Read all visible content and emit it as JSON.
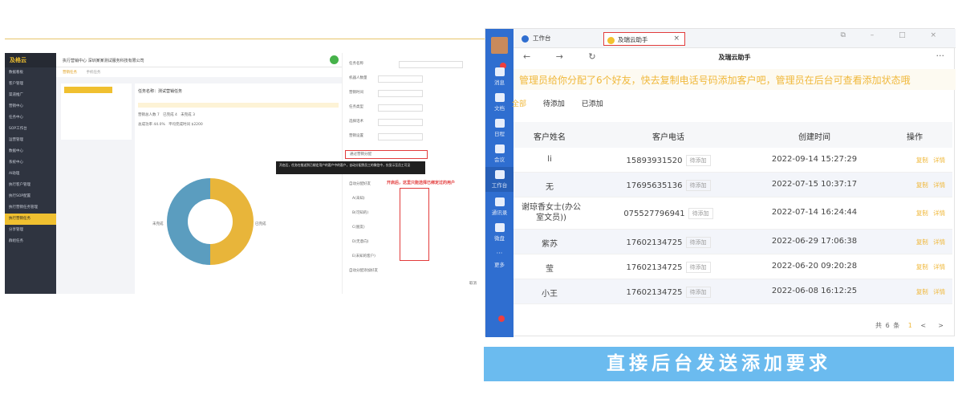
{
  "left_shot": {
    "logo": "及格云",
    "topbar_text": "执行营销中心   深圳某某测试服务科技有限公司",
    "tabs": [
      "营销任务",
      "手机任务"
    ],
    "sidebar": [
      "数据看板",
      "客户管理",
      "渠道推广",
      "营销中心",
      "任务中心",
      "SOP工作台",
      "运营管理",
      "数据中心",
      "系统中心",
      "AI助理",
      "执行客户管理",
      "执行SOP配置",
      "执行营销任务管理",
      "执行营销任务",
      "分享管理",
      "群组任务"
    ],
    "task_title": "任务名称：测试营销任务",
    "stats": [
      "营销总人数 7",
      "已完成 4",
      "未完成 3",
      "总成功率 44.0%",
      "平均完成时间 $2200"
    ],
    "legend_a": "已完成",
    "legend_b": "未完成",
    "form_labels": [
      "任务名称",
      "机器人数量",
      "营销时间",
      "任务类型",
      "选择话术",
      "营销设置"
    ],
    "checkbox_label": "通过营销分配",
    "annotation": "开启后，这里只能选择已绑定过的用户",
    "tooltip": "开启后，任务在推送到已绑定用户的客户中的客户，自动分配到员工的微信中，仅显示至员工可见",
    "assign_label": "自动分配好友",
    "rows": [
      "A(未知)",
      "B(可知的)",
      "C(朋友)",
      "D(无意向)",
      "E(未知的客户)"
    ],
    "auto_label": "自动分配添加好友",
    "submit": "取消"
  },
  "win": {
    "tab_workbench": "工作台",
    "tab_helper": "及瑞云助手",
    "nav_title": "及瑞云助手",
    "more": "···",
    "notice": "管理员给你分配了6个好友，快去复制电话号码添加客户吧，管理员在后台可查看添加状态哦",
    "subtabs": [
      "全部",
      "待添加",
      "已添加"
    ],
    "rail": [
      "消息",
      "文档",
      "日程",
      "会议",
      "工作台",
      "通讯录",
      "微盘",
      "更多"
    ],
    "columns": [
      "客户姓名",
      "客户电话",
      "创建时间",
      "操作"
    ],
    "rows": [
      {
        "name": "li",
        "phone": "15893931520",
        "status": "待添加",
        "time": "2022-09-14 15:27:29"
      },
      {
        "name": "无",
        "phone": "17695635136",
        "status": "待添加",
        "time": "2022-07-15 10:37:17"
      },
      {
        "name": "谢琼香女士(办公室文员))",
        "phone": "075527796941",
        "status": "待添加",
        "time": "2022-07-14 16:24:44"
      },
      {
        "name": "紫苏",
        "phone": "17602134725",
        "status": "待添加",
        "time": "2022-06-29 17:06:38"
      },
      {
        "name": "莹",
        "phone": "17602134725",
        "status": "待添加",
        "time": "2022-06-20 09:20:28"
      },
      {
        "name": "小王",
        "phone": "17602134725",
        "status": "待添加",
        "time": "2022-06-08 16:12:25"
      }
    ],
    "op_copy": "复制",
    "op_detail": "详情",
    "pager_total": "共 6 条",
    "pager_page": "1",
    "pager_prev": "<",
    "pager_next": ">"
  },
  "banner": "直接后台发送添加要求",
  "colors": {
    "accent": "#f0b83b",
    "rail": "#2f6ed0",
    "banner": "#6bbbef",
    "red": "#e23c3c"
  }
}
